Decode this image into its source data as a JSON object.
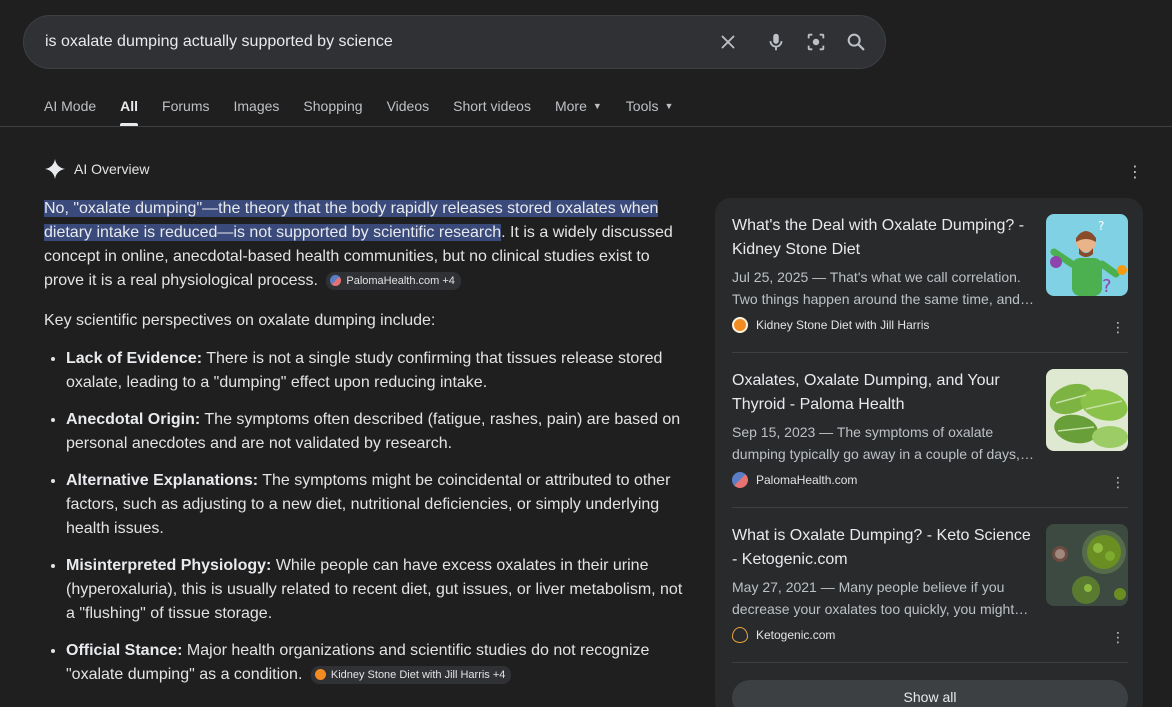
{
  "search": {
    "query": "is oxalate dumping actually supported by science",
    "icons": [
      "close-icon",
      "mic-icon",
      "lens-icon",
      "search-icon"
    ]
  },
  "tabs": [
    {
      "label": "AI Mode"
    },
    {
      "label": "All",
      "active": true
    },
    {
      "label": "Forums"
    },
    {
      "label": "Images"
    },
    {
      "label": "Shopping"
    },
    {
      "label": "Videos"
    },
    {
      "label": "Short videos"
    },
    {
      "label": "More",
      "dropdown": true
    },
    {
      "label": "Tools",
      "dropdown": true
    }
  ],
  "ai_overview": {
    "title": "AI Overview",
    "highlighted": "No, \"oxalate dumping\"—the theory that the body rapidly releases stored oxalates when dietary intake is reduced—is not supported by scientific research",
    "rest": ". It is a widely discussed concept in online, anecdotal-based health communities, but no clinical studies exist to prove it is a real physiological process.",
    "chip1": "PalomaHealth.com +4",
    "intro": "Key scientific perspectives on oxalate dumping include:",
    "points": [
      {
        "bold": "Lack of Evidence:",
        "text": " There is not a single study confirming that tissues release stored oxalate, leading to a \"dumping\" effect upon reducing intake."
      },
      {
        "bold": "Anecdotal Origin:",
        "text": " The symptoms often described (fatigue, rashes, pain) are based on personal anecdotes and are not validated by research."
      },
      {
        "bold": "Alternative Explanations:",
        "text": " The symptoms might be coincidental or attributed to other factors, such as adjusting to a new diet, nutritional deficiencies, or simply underlying health issues."
      },
      {
        "bold": "Misinterpreted Physiology:",
        "text": " While people can have excess oxalates in their urine (hyperoxaluria), this is usually related to recent diet, gut issues, or liver metabolism, not a \"flushing\" of tissue storage."
      },
      {
        "bold": "Official Stance:",
        "text": " Major health organizations and scientific studies do not recognize \"oxalate dumping\" as a condition."
      }
    ],
    "chip2": "Kidney Stone Diet with Jill Harris +4"
  },
  "sources": [
    {
      "title": "What's the Deal with Oxalate Dumping? - Kidney Stone Diet",
      "snippet": "Jul 25, 2025 — That's what we call correlation. Two things happen around the same time, and…",
      "source": "Kidney Stone Diet with Jill Harris",
      "icon_color": "#f28b22"
    },
    {
      "title": "Oxalates, Oxalate Dumping, and Your Thyroid - Paloma Health",
      "snippet": "Sep 15, 2023 — The symptoms of oxalate dumping typically go away in a couple of days,…",
      "source": "PalomaHealth.com",
      "icon_color": "#5b7fc7"
    },
    {
      "title": "What is Oxalate Dumping? - Keto Science - Ketogenic.com",
      "snippet": "May 27, 2021 — Many people believe if you decrease your oxalates too quickly, you might…",
      "source": "Ketogenic.com",
      "icon_color": "#e8a33b"
    }
  ],
  "show_all": "Show all"
}
